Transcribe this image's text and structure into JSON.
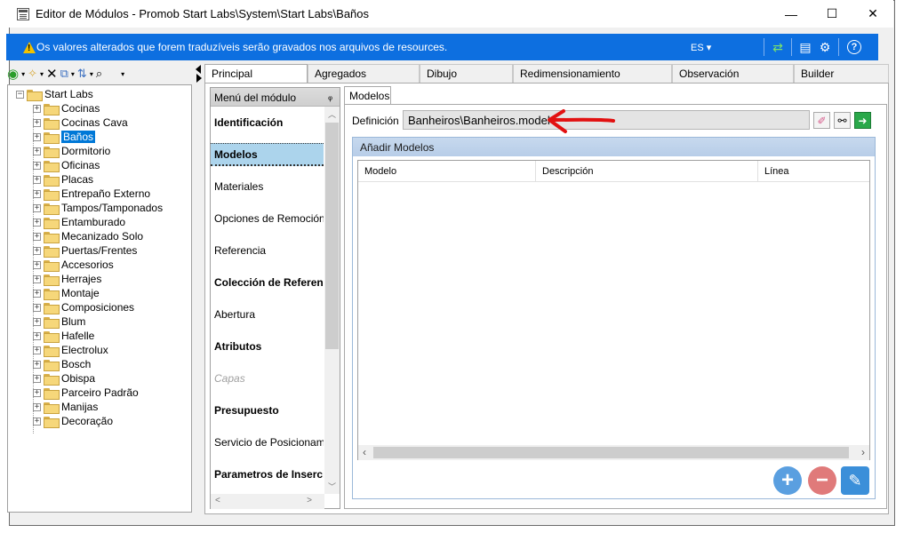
{
  "window": {
    "title": "Editor de Módulos - Promob Start Labs\\System\\Start Labs\\Baños",
    "controls": {
      "minimize": "—",
      "maximize": "☐",
      "close": "✕"
    }
  },
  "banner": {
    "message": "Os valores alterados que forem traduzíveis serão gravados nos arquivos de resources.",
    "language": "ES ▾",
    "icons": [
      "refresh-icon",
      "layout-icon",
      "settings-icon",
      "help-icon"
    ],
    "color": "#0d6fe0"
  },
  "toolbar": {
    "icons": [
      "back-icon",
      "new-icon",
      "delete-icon",
      "copy-icon",
      "sort-icon",
      "find-icon",
      "overflow-icon"
    ]
  },
  "tree": {
    "root": "Start Labs",
    "items": [
      {
        "label": "Cocinas"
      },
      {
        "label": "Cocinas Cava"
      },
      {
        "label": "Baños",
        "selected": true
      },
      {
        "label": "Dormitorio"
      },
      {
        "label": "Oficinas"
      },
      {
        "label": "Placas"
      },
      {
        "label": "Entrepaño Externo"
      },
      {
        "label": "Tampos/Tamponados"
      },
      {
        "label": "Entamburado"
      },
      {
        "label": "Mecanizado Solo"
      },
      {
        "label": "Puertas/Frentes"
      },
      {
        "label": "Accesorios"
      },
      {
        "label": "Herrajes"
      },
      {
        "label": "Montaje"
      },
      {
        "label": "Composiciones"
      },
      {
        "label": "Blum"
      },
      {
        "label": "Hafelle"
      },
      {
        "label": "Electrolux"
      },
      {
        "label": "Bosch"
      },
      {
        "label": "Obispa"
      },
      {
        "label": "Parceiro Padrão"
      },
      {
        "label": "Manijas"
      },
      {
        "label": "Decoração"
      }
    ]
  },
  "tabs": [
    {
      "label": "Principal",
      "active": true
    },
    {
      "label": "Agregados"
    },
    {
      "label": "Dibujo"
    },
    {
      "label": "Redimensionamiento"
    },
    {
      "label": "Observación"
    },
    {
      "label": "Builder"
    }
  ],
  "module_menu": {
    "header": "Menú del módulo",
    "pin": "ᵩ",
    "items": [
      {
        "label": "Identificación",
        "style": "bold"
      },
      {
        "label": "Modelos",
        "style": "bold",
        "active": true
      },
      {
        "label": "Materiales",
        "style": "normal"
      },
      {
        "label": "Opciones de Remoción",
        "style": "normal"
      },
      {
        "label": "Referencia",
        "style": "normal"
      },
      {
        "label": "Colección de Referencia",
        "style": "bold"
      },
      {
        "label": "Abertura",
        "style": "normal"
      },
      {
        "label": "Atributos",
        "style": "bold"
      },
      {
        "label": "Capas",
        "style": "italic"
      },
      {
        "label": "Presupuesto",
        "style": "bold"
      },
      {
        "label": "Servicio de Posicionamiento",
        "style": "normal"
      },
      {
        "label": "Parametros de Inserción",
        "style": "bold"
      }
    ]
  },
  "models_panel": {
    "subtab": "Modelos",
    "definition_label": "Definición",
    "definition_value": "Banheiros\\Banheiros.model",
    "group_title": "Añadir Modelos",
    "columns": [
      "Modelo",
      "Descripción",
      "Línea"
    ],
    "buttons": {
      "add": "+",
      "remove": "−",
      "edit": "✎"
    }
  }
}
